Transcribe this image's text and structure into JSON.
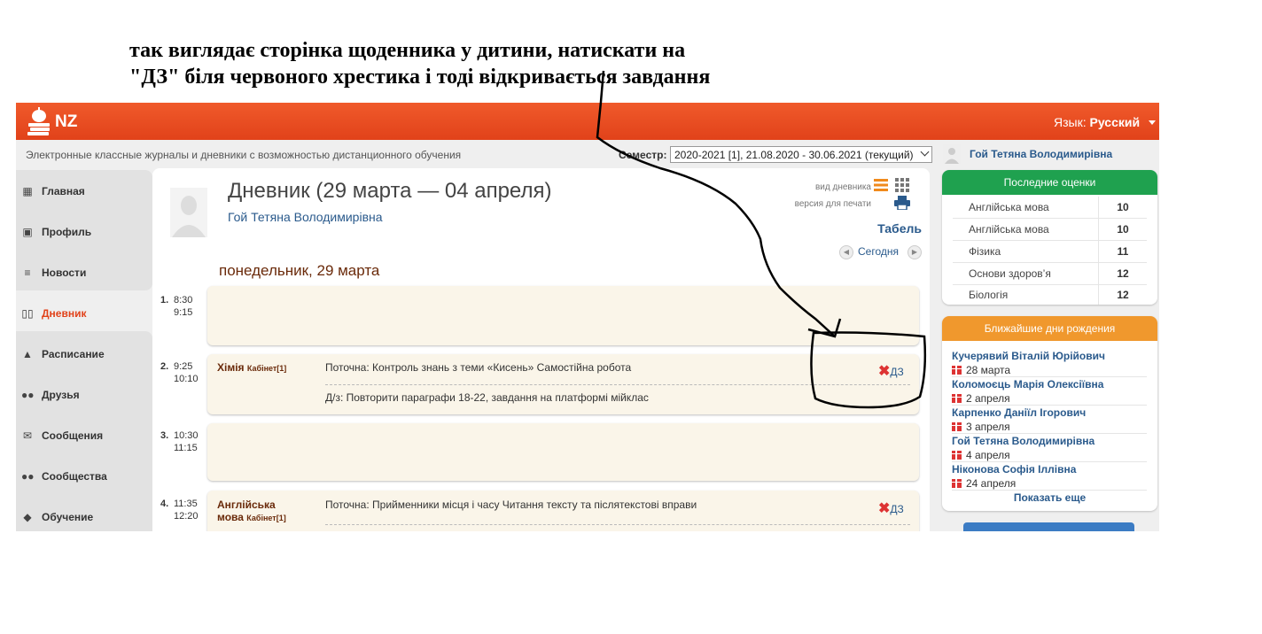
{
  "caption": {
    "line1": "так виглядає сторінка щоденника у дитини, натискати на",
    "line2": "\"ДЗ\" біля червоного хрестика і тоді відкривається завдання"
  },
  "header": {
    "logo_text": "NZ",
    "lang_label": "Язык:",
    "lang_value": "Русский"
  },
  "subbar": {
    "tagline": "Электронные классные журналы и дневники с возможностью дистанционного обучения",
    "semester_label": "Семестр:",
    "semester_value": "2020-2021 [1], 21.08.2020 - 30.06.2021 (текущий)",
    "user_name": "Гой Тетяна Володимирівна"
  },
  "sidebar": {
    "items": [
      {
        "label": "Главная",
        "icon": "grid-icon"
      },
      {
        "label": "Профиль",
        "icon": "profile-icon"
      },
      {
        "label": "Новости",
        "icon": "news-icon"
      },
      {
        "label": "Дневник",
        "icon": "book-icon",
        "active": true
      },
      {
        "label": "Расписание",
        "icon": "bell-icon"
      },
      {
        "label": "Друзья",
        "icon": "friends-icon"
      },
      {
        "label": "Сообщения",
        "icon": "mail-icon"
      },
      {
        "label": "Сообщества",
        "icon": "community-icon"
      },
      {
        "label": "Обучение",
        "icon": "graduation-cap-icon"
      }
    ]
  },
  "diary": {
    "title": "Дневник (29 марта — 04 апреля)",
    "student": "Гой Тетяна Володимирівна",
    "view_label": "вид дневника",
    "print_label": "версия для печати",
    "tabel": "Табель",
    "today": "Сегодня",
    "day_head": "понедельник, 29 марта",
    "lessons": [
      {
        "num": "1.",
        "start": "8:30",
        "end": "9:15"
      },
      {
        "num": "2.",
        "start": "9:25",
        "end": "10:10",
        "subject": "Хімія",
        "cabinet": "Кабінет[1]",
        "topic": "Поточна: Контроль знань з теми «Кисень» Самостійна робота",
        "homework": "Д/з: Повторити параграфи 18-22, завдання на платформі мійклас",
        "dz": "ДЗ"
      },
      {
        "num": "3.",
        "start": "10:30",
        "end": "11:15"
      },
      {
        "num": "4.",
        "start": "11:35",
        "end": "12:20",
        "subject_line1": "Англійська",
        "subject_line2": "мова",
        "cabinet": "Кабінет[1]",
        "topic": "Поточна: Прийменники місця і часу Читання тексту та післятекстові вправи",
        "dz": "ДЗ"
      }
    ]
  },
  "grades": {
    "title": "Последние оценки",
    "rows": [
      {
        "subject": "Англійська мова",
        "grade": "10"
      },
      {
        "subject": "Англійська мова",
        "grade": "10"
      },
      {
        "subject": "Фізика",
        "grade": "11"
      },
      {
        "subject": "Основи здоров’я",
        "grade": "12"
      },
      {
        "subject": "Біологія",
        "grade": "12"
      }
    ],
    "header_color": "#1fa14f"
  },
  "birthdays": {
    "title": "Ближайшие дни рождения",
    "people": [
      {
        "name": "Кучерявий Віталій Юрійович",
        "date": "28 марта"
      },
      {
        "name": "Коломоєць Марія Олексіївна",
        "date": "2 апреля"
      },
      {
        "name": "Карпенко Даніїл Ігорович",
        "date": "3 апреля"
      },
      {
        "name": "Гой Тетяна Володимирівна",
        "date": "4 апреля"
      },
      {
        "name": "Ніконова Софія Іллівна",
        "date": "24 апреля"
      }
    ],
    "more": "Показать еще",
    "header_color": "#f0982d"
  },
  "colors": {
    "brand": "#e1421a",
    "link": "#2a5a8c",
    "card": "#faf5e9"
  }
}
